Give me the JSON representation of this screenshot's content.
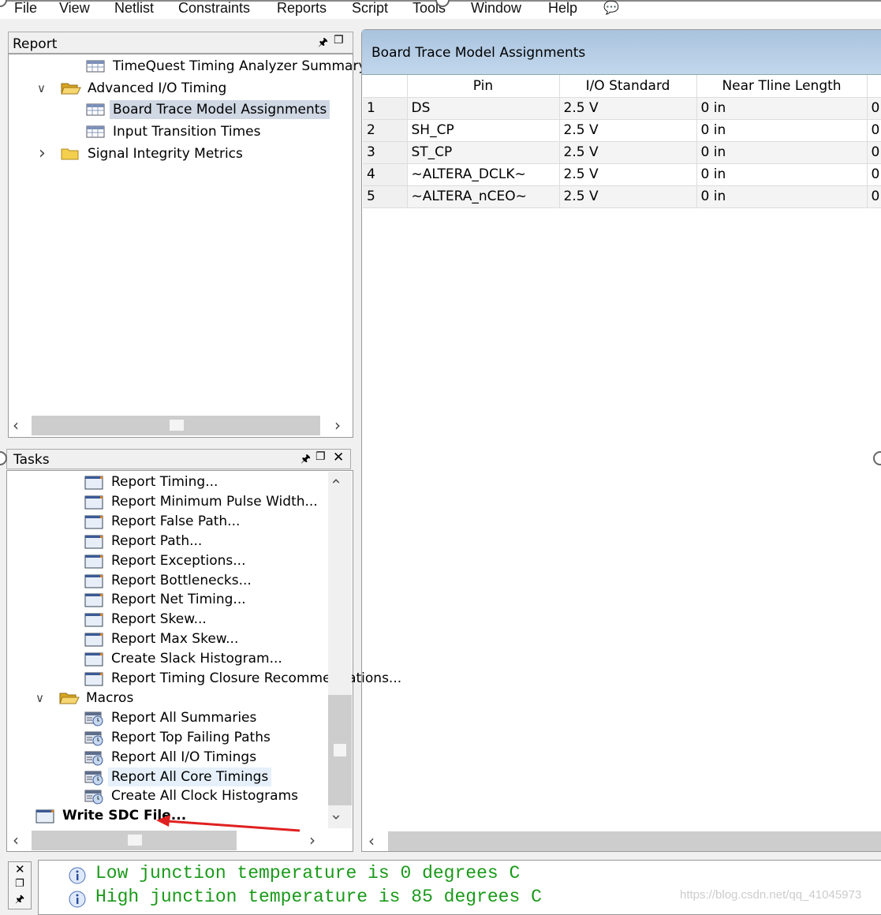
{
  "menu": [
    "File",
    "View",
    "Netlist",
    "Constraints",
    "Reports",
    "Script",
    "Tools",
    "Window",
    "Help"
  ],
  "report_panel": {
    "title": "Report",
    "items": [
      {
        "label": "TimeQuest Timing Analyzer Summary",
        "icon": "table-icon",
        "level": 2
      },
      {
        "label": "Advanced I/O Timing",
        "icon": "folder-open-icon",
        "level": 1,
        "expanded": true
      },
      {
        "label": "Board Trace Model Assignments",
        "icon": "table-icon",
        "level": 2,
        "selected": true
      },
      {
        "label": "Input Transition Times",
        "icon": "table-icon",
        "level": 2
      },
      {
        "label": "Signal Integrity Metrics",
        "icon": "folder-icon",
        "level": 1,
        "expanded": false
      }
    ]
  },
  "main": {
    "title": "Board Trace Model Assignments",
    "columns": [
      "",
      "Pin",
      "I/O Standard",
      "Near Tline Length",
      ""
    ],
    "rows": [
      [
        "1",
        "DS",
        "2.5 V",
        "0 in",
        "0"
      ],
      [
        "2",
        "SH_CP",
        "2.5 V",
        "0 in",
        "0"
      ],
      [
        "3",
        "ST_CP",
        "2.5 V",
        "0 in",
        "0"
      ],
      [
        "4",
        "~ALTERA_DCLK~",
        "2.5 V",
        "0 in",
        "0"
      ],
      [
        "5",
        "~ALTERA_nCEO~",
        "2.5 V",
        "0 in",
        "0"
      ]
    ]
  },
  "tasks_panel": {
    "title": "Tasks",
    "items": [
      {
        "label": "Report Timing...",
        "icon": "window-icon",
        "level": 2
      },
      {
        "label": "Report Minimum Pulse Width...",
        "icon": "window-icon",
        "level": 2
      },
      {
        "label": "Report False Path...",
        "icon": "window-icon",
        "level": 2
      },
      {
        "label": "Report Path...",
        "icon": "window-icon",
        "level": 2
      },
      {
        "label": "Report Exceptions...",
        "icon": "window-icon",
        "level": 2
      },
      {
        "label": "Report Bottlenecks...",
        "icon": "window-icon",
        "level": 2
      },
      {
        "label": "Report Net Timing...",
        "icon": "window-icon",
        "level": 2
      },
      {
        "label": "Report Skew...",
        "icon": "window-icon",
        "level": 2
      },
      {
        "label": "Report Max Skew...",
        "icon": "window-icon",
        "level": 2
      },
      {
        "label": "Create Slack Histogram...",
        "icon": "window-icon",
        "level": 2
      },
      {
        "label": "Report Timing Closure Recommendations...",
        "icon": "window-icon",
        "level": 2
      },
      {
        "label": "Macros",
        "icon": "folder-open-icon",
        "level": 1,
        "expanded": true
      },
      {
        "label": "Report All Summaries",
        "icon": "macro-clock-icon",
        "level": 2
      },
      {
        "label": "Report Top Failing Paths",
        "icon": "macro-clock-icon",
        "level": 2
      },
      {
        "label": "Report All I/O Timings",
        "icon": "macro-clock-icon",
        "level": 2
      },
      {
        "label": "Report All Core Timings",
        "icon": "macro-clock-icon",
        "level": 2,
        "highlighted": true
      },
      {
        "label": "Create All Clock Histograms",
        "icon": "macro-clock-icon",
        "level": 2
      },
      {
        "label": "Write SDC File...",
        "icon": "window-icon",
        "level": 0,
        "bold": true
      }
    ]
  },
  "messages": [
    "Low junction temperature is 0 degrees C",
    "High junction temperature is 85 degrees C"
  ],
  "watermark": "https://blog.csdn.net/qq_41045973",
  "colors": {
    "header_blue": "#b4cde6",
    "message_green": "#1a9a1a",
    "selection": "#cce4f7",
    "annotation_arrow": "#e02020"
  }
}
